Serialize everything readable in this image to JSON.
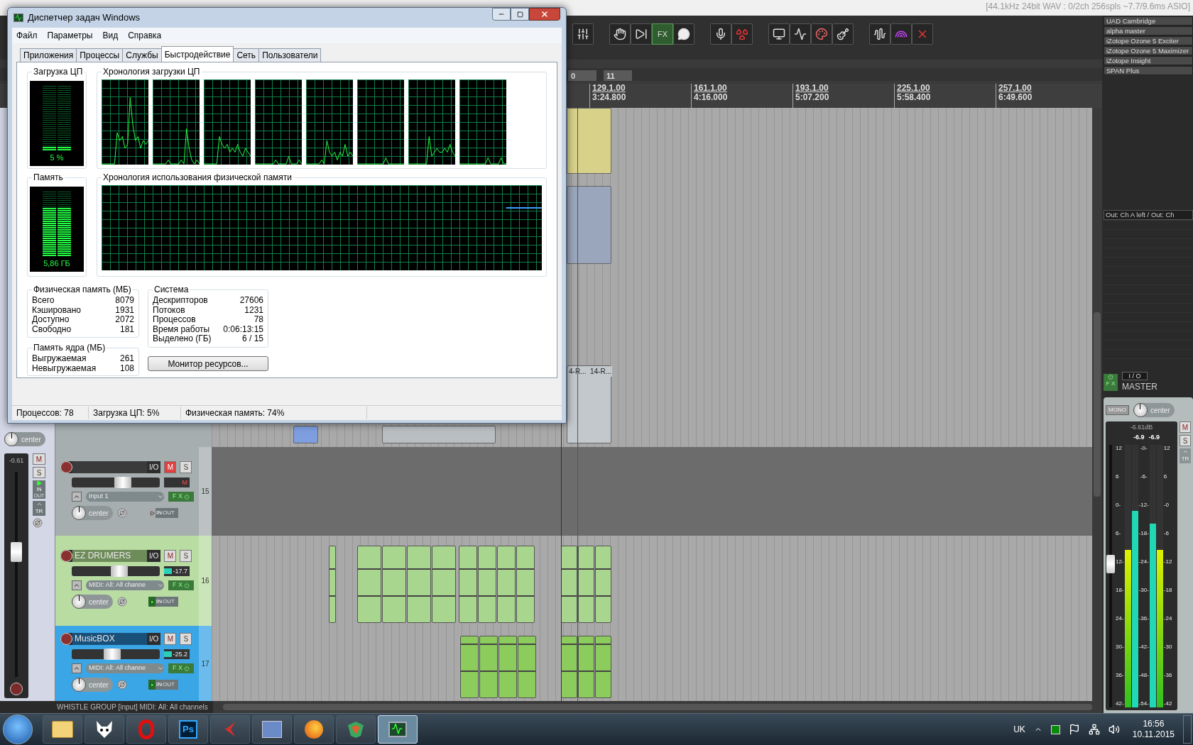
{
  "daw": {
    "audio_status": "[44.1kHz 24bit WAV : 0/2ch 256spls ~7.7/9.6ms ASIO]",
    "toolbar_fx": "FX",
    "regions": [
      "0",
      "11"
    ],
    "ruler": [
      {
        "bar": "129.1.00",
        "time": "3:24.800"
      },
      {
        "bar": "161.1.00",
        "time": "4:16.000"
      },
      {
        "bar": "193.1.00",
        "time": "5:07.200"
      },
      {
        "bar": "225.1.00",
        "time": "5:58.400"
      },
      {
        "bar": "257.1.00",
        "time": "6:49.600"
      }
    ],
    "item_labels": [
      "4-R...",
      "14-R..."
    ],
    "fx_chain": [
      "UAD Cambridge",
      "alpha master",
      "iZotope Ozone 5 Exciter",
      "iZotope Ozone 5 Maximizer",
      "iZotope Insight",
      "SPAN Plus"
    ],
    "routing": "Out: Ch A left / Out: Ch",
    "strip": {
      "pan": "center",
      "volume": "-0.61",
      "level": 0.62,
      "mute": "M",
      "solo": "S",
      "in": "IN",
      "out": "OUT",
      "trim": "TR"
    },
    "tracks": [
      {
        "number": "15",
        "color": "#a6aeb0",
        "input": "Input 1",
        "pan": "center",
        "level": 0.6,
        "meter_text": "M",
        "muted": true,
        "monitor": false,
        "io": "I/O",
        "mute": "M",
        "solo": "S",
        "fx": "F X",
        "in": "IN",
        "out": "OUT"
      },
      {
        "number": "16",
        "name": "EZ DRUMERS",
        "color": "#b9dca2",
        "input": "MIDI: All: All channe",
        "pan": "center",
        "level": 0.55,
        "meter_text": "-17.7",
        "meter": {
          "level": 0.55
        },
        "muted": false,
        "monitor": true,
        "io": "I/O",
        "mute": "M",
        "solo": "S",
        "fx": "F X",
        "in": "IN",
        "out": "OUT"
      },
      {
        "number": "17",
        "name": "MusicBOX",
        "color": "#3aa6e6",
        "input": "MIDI: All: All channe",
        "pan": "center",
        "level": 0.45,
        "meter_text": "-25.2",
        "meter": {
          "level": 0.35
        },
        "muted": false,
        "monitor": true,
        "io": "I/O",
        "mute": "M",
        "solo": "S",
        "fx": "F X",
        "in": "IN",
        "out": "OUT"
      }
    ],
    "bottom_status": "WHISTLE GROUP [input] MIDI: All: All channels",
    "master": {
      "fx": "F X",
      "io": "I / O",
      "label": "MASTER",
      "mono": "MONO",
      "pan": "center",
      "peak": "-6.61dB",
      "peaks": [
        "-6.9",
        "-6.9"
      ],
      "mute": "M",
      "solo": "S",
      "trim": "TR",
      "level": 0.55,
      "meters": [
        {
          "kind": "outer",
          "level": 0.6
        },
        {
          "kind": "inner",
          "level": 0.75
        },
        {
          "kind": "inner",
          "level": 0.7
        },
        {
          "kind": "outer",
          "level": 0.6
        }
      ],
      "left_scale": [
        "12",
        "6",
        "0-",
        "6-",
        "12-",
        "18-",
        "24-",
        "30-",
        "36-",
        "42-"
      ],
      "inner_scale": [
        "-0-",
        "-6-",
        "-12-",
        "-18-",
        "-24-",
        "-30-",
        "-36-",
        "-42-",
        "-48-",
        "-54-"
      ],
      "right_scale": [
        "12",
        "6",
        "-0",
        "-6",
        "-12",
        "-18",
        "-24",
        "-30",
        "-36",
        "-42"
      ]
    }
  },
  "task_manager": {
    "title": "Диспетчер задач Windows",
    "menu": [
      "Файл",
      "Параметры",
      "Вид",
      "Справка"
    ],
    "tabs": [
      {
        "label": "Приложения",
        "selected": false
      },
      {
        "label": "Процессы",
        "selected": false
      },
      {
        "label": "Службы",
        "selected": false
      },
      {
        "label": "Быстродействие",
        "selected": true
      },
      {
        "label": "Сеть",
        "selected": false
      },
      {
        "label": "Пользователи",
        "selected": false
      }
    ],
    "cpu": {
      "title": "Загрузка ЦП",
      "reading": "5 %",
      "level": 0.05
    },
    "cpu_history": {
      "title": "Хронология загрузки ЦП"
    },
    "memory": {
      "title": "Память",
      "reading": "5,86 ГБ",
      "level": 0.74
    },
    "memory_history": {
      "title": "Хронология использования физической памяти"
    },
    "physical": {
      "title": "Физическая память (МБ)",
      "rows": [
        {
          "label": "Всего",
          "value": "8079"
        },
        {
          "label": "Кэшировано",
          "value": "1931"
        },
        {
          "label": "Доступно",
          "value": "2072"
        },
        {
          "label": "Свободно",
          "value": "181"
        }
      ]
    },
    "kernel": {
      "title": "Память ядра (МБ)",
      "rows": [
        {
          "label": "Выгружаемая",
          "value": "261"
        },
        {
          "label": "Невыгружаемая",
          "value": "108"
        }
      ]
    },
    "system": {
      "title": "Система",
      "rows": [
        {
          "label": "Дескрипторов",
          "value": "27606"
        },
        {
          "label": "Потоков",
          "value": "1231"
        },
        {
          "label": "Процессов",
          "value": "78"
        },
        {
          "label": "Время работы",
          "value": "0:06:13:15"
        },
        {
          "label": "Выделено (ГБ)",
          "value": "6 / 15"
        }
      ]
    },
    "resource_button": "Монитор ресурсов...",
    "status": [
      "Процессов: 78",
      "Загрузка ЦП: 5%",
      "Физическая память: 74%"
    ]
  },
  "taskbar": {
    "items": [
      {
        "kind": "folder",
        "selected": false
      },
      {
        "kind": "fox",
        "selected": false
      },
      {
        "kind": "opera",
        "selected": false
      },
      {
        "kind": "photoshop",
        "label": "Ps",
        "selected": false
      },
      {
        "kind": "arrow",
        "selected": false
      },
      {
        "kind": "window",
        "selected": false
      },
      {
        "kind": "firefox",
        "selected": false
      },
      {
        "kind": "shield",
        "selected": false
      },
      {
        "kind": "taskmgr",
        "selected": true
      }
    ],
    "language": "UK",
    "time": "16:56",
    "date": "10.11.2015"
  }
}
